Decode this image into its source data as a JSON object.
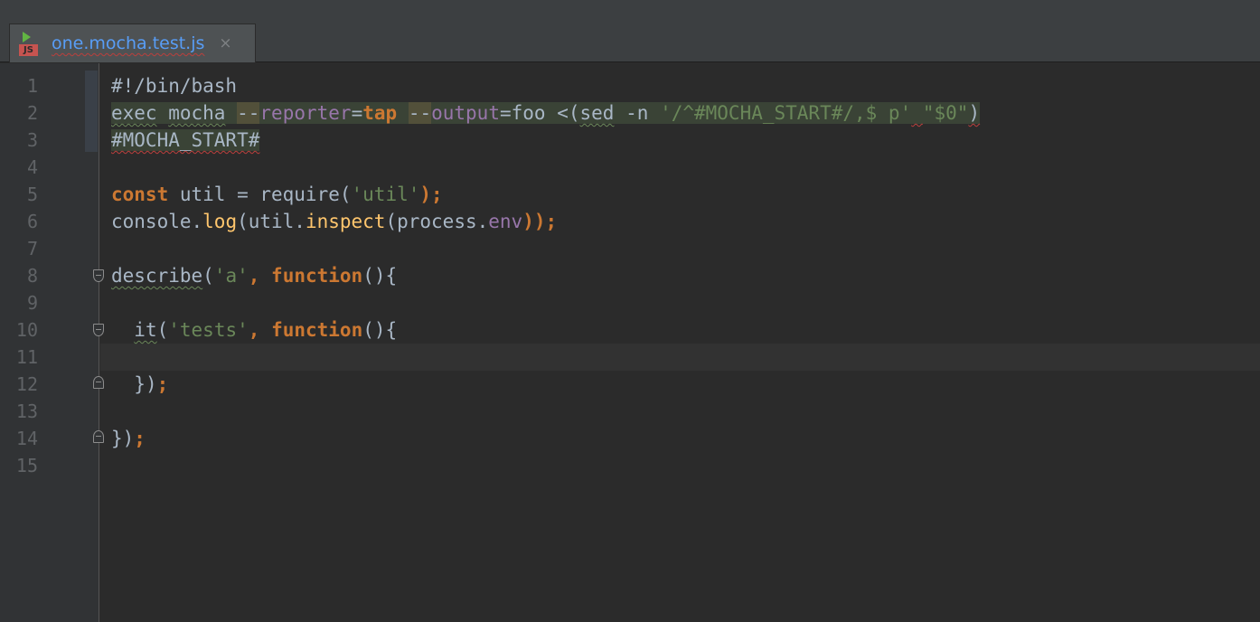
{
  "tab": {
    "filename": "one.mocha.test.js",
    "icon_badge": "JS",
    "close_glyph": "×"
  },
  "colors": {
    "background": "#2b2b2b",
    "gutter": "#313335",
    "keyword": "#cc7832",
    "string": "#6a8759",
    "function": "#ffc66d",
    "property": "#9876aa",
    "text": "#a9b7c6",
    "line_number": "#606366",
    "tab_text": "#589df6"
  },
  "editor": {
    "line_numbers": [
      "1",
      "2",
      "3",
      "4",
      "5",
      "6",
      "7",
      "8",
      "9",
      "10",
      "11",
      "12",
      "13",
      "14",
      "15"
    ],
    "lines": {
      "l1": "#!/bin/bash",
      "l2": {
        "exec": "exec",
        "sp1": " ",
        "mocha": "mocha",
        "sp2": " ",
        "dd1": "--",
        "reporter": "reporter",
        "eq1": "=",
        "tap": "tap",
        "sp3": " ",
        "dd2": "--",
        "output": "output",
        "eq2": "=",
        "foo": "foo",
        "sp4": " ",
        "proc": "<(",
        "sed": "sed",
        "sp5": " ",
        "flag": "-n",
        "sp6": " ",
        "sedexpr": "'/^#MOCHA_START#/,$ p'",
        "sp7": " ",
        "arg": "\"$0\"",
        "closeparen": ")"
      },
      "l3": "#MOCHA_START#",
      "l5": {
        "const": "const",
        "decl": " util = require(",
        "util_str": "'util'",
        "end": ");"
      },
      "l6": {
        "console": "console.",
        "log": "log",
        "mid": "(util.",
        "inspect": "inspect",
        "mid2": "(process.",
        "env": "env",
        "end": "));"
      },
      "l8": {
        "describe": "describe",
        "open": "(",
        "a_str": "'a'",
        "comma": ", ",
        "function": "function",
        "end": "(){"
      },
      "l10": {
        "indent": "  ",
        "it": "it",
        "open": "(",
        "tests_str": "'tests'",
        "comma": ", ",
        "function": "function",
        "end": "(){"
      },
      "l12": {
        "indent": "  ",
        "close": "})",
        "semi": ";"
      },
      "l14": {
        "close": "})",
        "semi": ";"
      }
    }
  }
}
